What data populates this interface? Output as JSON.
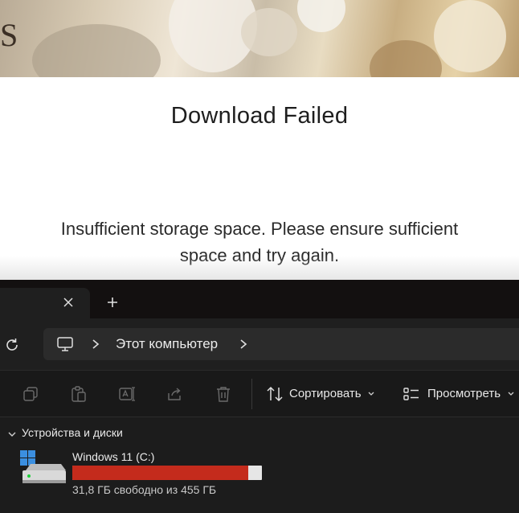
{
  "dialog": {
    "title": "Download Failed",
    "message": "Insufficient storage space. Please ensure sufficient space and try again."
  },
  "explorer": {
    "tab": {
      "close_icon": "close-icon",
      "add_icon": "plus-icon"
    },
    "nav": {
      "refresh_icon": "refresh-icon",
      "location_icon": "computer-icon",
      "location": "Этот компьютер"
    },
    "toolbar": {
      "icons": [
        "copy-icon",
        "paste-icon",
        "rename-icon",
        "share-icon",
        "delete-icon"
      ],
      "sort_label": "Сортировать",
      "view_label": "Просмотреть"
    },
    "group": {
      "header": "Устройства и диски",
      "drives": [
        {
          "name": "Windows 11 (C:)",
          "free_text": "31,8 ГБ свободно из 455 ГБ",
          "used_fraction": 0.93
        }
      ]
    }
  },
  "colors": {
    "explorer_bg": "#1c1c1c",
    "usage_bar_critical": "#c42b1c",
    "usage_bar_track": "#e6e6e6",
    "windows_logo": "#3b8fe0"
  }
}
